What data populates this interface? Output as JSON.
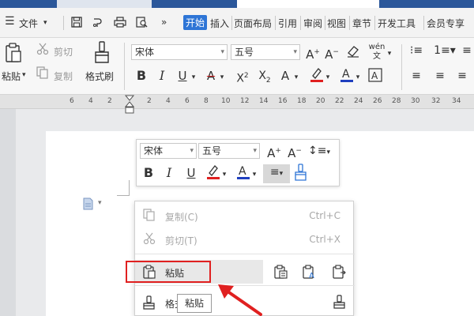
{
  "menu": {
    "file": "文件",
    "tabs": [
      "开始",
      "插入",
      "页面布局",
      "引用",
      "审阅",
      "视图",
      "章节",
      "开发工具",
      "会员专享"
    ],
    "active_tab": "开始"
  },
  "ribbon": {
    "paste": "粘贴",
    "cut": "剪切",
    "copy": "复制",
    "format_painter": "格式刷",
    "font_name": "宋体",
    "font_size": "五号"
  },
  "ruler": {
    "numbers": [
      "6",
      "4",
      "2",
      "2",
      "4",
      "6",
      "8",
      "10",
      "12",
      "14",
      "16",
      "18",
      "20",
      "22",
      "24",
      "26",
      "28",
      "30",
      "32",
      "34"
    ]
  },
  "mini_toolbar": {
    "font_name": "宋体",
    "font_size": "五号"
  },
  "context_menu": {
    "items": [
      {
        "label": "复制(C)",
        "shortcut": "Ctrl+C"
      },
      {
        "label": "剪切(T)",
        "shortcut": "Ctrl+X"
      },
      {
        "label": "粘贴",
        "shortcut": ""
      },
      {
        "label": "格式",
        "shortcut": ""
      }
    ]
  },
  "tooltip": "粘贴",
  "colors": {
    "accent": "#2e75d6",
    "highlight_box": "#e02020",
    "arrow": "#e02020",
    "title_bar": "#2b579a"
  }
}
